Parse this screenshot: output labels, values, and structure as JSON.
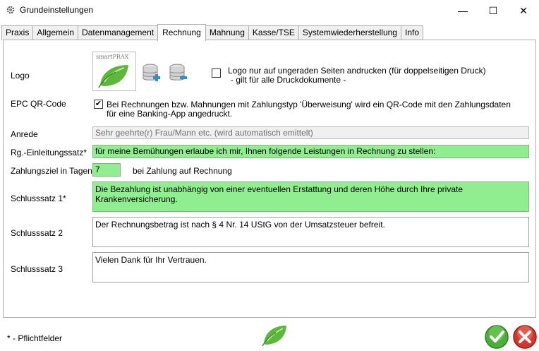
{
  "window": {
    "title": "Grundeinstellungen",
    "minimize": "—",
    "maximize": "☐",
    "close": "✕"
  },
  "tabs": [
    {
      "label": "Praxis",
      "active": false
    },
    {
      "label": "Allgemein",
      "active": false
    },
    {
      "label": "Datenmanagement",
      "active": false
    },
    {
      "label": "Rechnung",
      "active": true
    },
    {
      "label": "Mahnung",
      "active": false
    },
    {
      "label": "Kasse/TSE",
      "active": false
    },
    {
      "label": "Systemwiederherstellung",
      "active": false
    },
    {
      "label": "Info",
      "active": false
    }
  ],
  "logo": {
    "label": "Logo",
    "brand": "smartPRAX",
    "odd_pages_checked": false,
    "odd_pages_line1": "Logo nur auf ungeraden Seiten andrucken (für doppelseitigen Druck)",
    "odd_pages_line2": "- gilt für alle Druckdokumente -"
  },
  "epc": {
    "label": "EPC QR-Code",
    "checked": true,
    "check_mark": "✔",
    "text_line1": "Bei Rechnungen bzw. Mahnungen mit Zahlungstyp 'Überweisung' wird ein QR-Code mit den Zahlungsdaten",
    "text_line2": "für eine Banking-App angedruckt."
  },
  "anrede": {
    "label": "Anrede",
    "value": "Sehr geehrte(r) Frau/Mann etc. (wird automatisch emittelt)"
  },
  "einleitung": {
    "label": "Rg.-Einleitungssatz*",
    "value": "für meine Bemühungen erlaube ich mir, Ihnen folgende Leistungen in Rechnung zu stellen:"
  },
  "zahlungsziel": {
    "label": "Zahlungsziel in Tagen*",
    "value": "7",
    "suffix": "bei Zahlung auf Rechnung"
  },
  "schluss1": {
    "label": "Schlusssatz 1*",
    "value": "Die Bezahlung ist unabhängig von einer eventuellen Erstattung und deren Höhe durch Ihre private Krankenversicherung."
  },
  "schluss2": {
    "label": "Schlusssatz 2",
    "value": "Der Rechnungsbetrag ist nach § 4 Nr. 14 UStG von der Umsatzsteuer befreit."
  },
  "schluss3": {
    "label": "Schlusssatz 3",
    "value": "Vielen Dank für Ihr Vertrauen."
  },
  "footer": {
    "required_note": "* - Pflichtfelder"
  },
  "colors": {
    "required_field": "#90ee90",
    "ok": "#4caf3a",
    "cancel": "#d9362b"
  }
}
